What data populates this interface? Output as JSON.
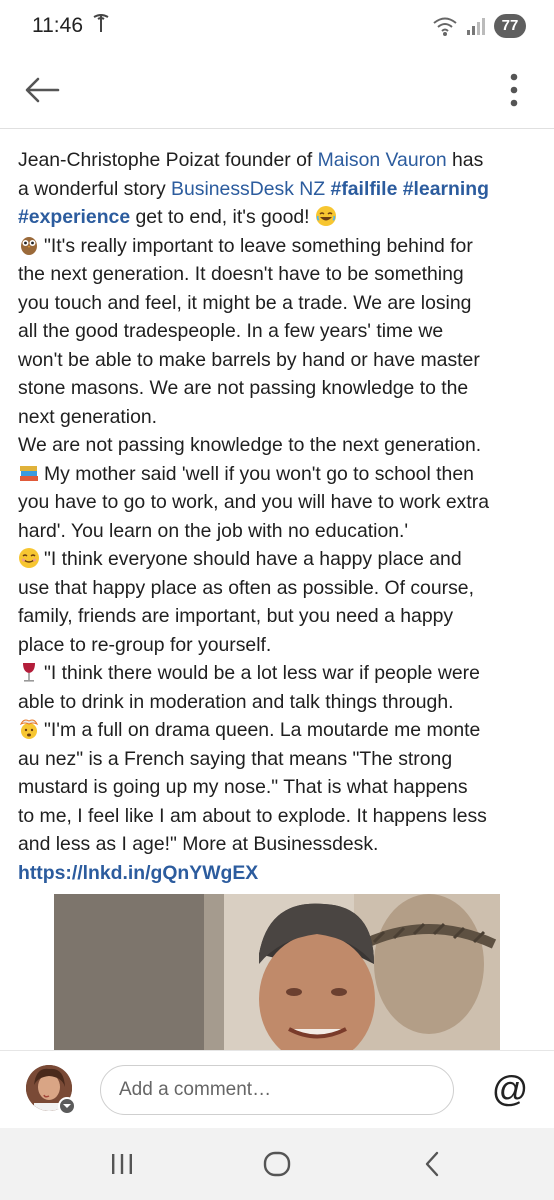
{
  "status_bar": {
    "time": "11:46",
    "battery": "77"
  },
  "app_bar": {
    "back_icon": "arrow-left-icon",
    "more_icon": "more-vertical-icon"
  },
  "post": {
    "line1": {
      "a": "Jean-Christophe Poizat founder of ",
      "b": "Maison Vauron",
      "c": " has"
    },
    "line2": {
      "a": "a wonderful story ",
      "b": "BusinessDesk NZ",
      "c": " ",
      "d": "#failfile",
      "e": " ",
      "f": "#learning"
    },
    "line3": {
      "a": "#experience",
      "b": "  get to end, it's good! "
    },
    "line4": "\"It's really important to leave something behind for",
    "line5": "the next generation. It doesn't have to be something",
    "line6": "you touch and feel, it might be a trade. We are losing",
    "line7": "all the good tradespeople. In a few years' time we",
    "line8": "won't be able to make barrels by hand or have master",
    "line9": "stone masons. We are not passing knowledge to the",
    "line10": "next generation.",
    "line11": "We are not passing knowledge to the next generation.",
    "line12": "My mother said 'well if you won't go to school then",
    "line13": "you have to go to work, and you will have to work extra",
    "line14": "hard'. You learn on the job with no education.'",
    "line15": "\"I think everyone should have a happy place and",
    "line16": "use that happy place as often as possible. Of course,",
    "line17": "family, friends are important, but you need a happy",
    "line18": "place to re-group for yourself.",
    "line19": "\"I think there would be a lot less war if people were",
    "line20": "able to drink in moderation and talk things through.",
    "line21": "\"I'm a full on drama queen. La moutarde me monte",
    "line22": "au nez\" is a French saying that means \"The strong",
    "line23": "mustard is going up my nose.\" That is what happens",
    "line24": "to me, I feel like I am about to explode. It happens less",
    "line25": "and less as I age!\" More at Businessdesk.",
    "url": "https://lnkd.in/gQnYWgEX",
    "emojis": [
      "laughing-emoji",
      "owl-emoji",
      "books-emoji",
      "smiling-emoji",
      "wine-glass-emoji",
      "exploding-head-emoji"
    ]
  },
  "comment_bar": {
    "placeholder": "Add a comment…",
    "mention": "@"
  },
  "nav_bar": {
    "recents_icon": "recents-icon",
    "home_icon": "home-icon",
    "back_icon": "nav-back-icon"
  },
  "colors": {
    "link": "#2c5c9e",
    "text": "#1f1f1f",
    "nav_bg": "#f2f2f2"
  }
}
